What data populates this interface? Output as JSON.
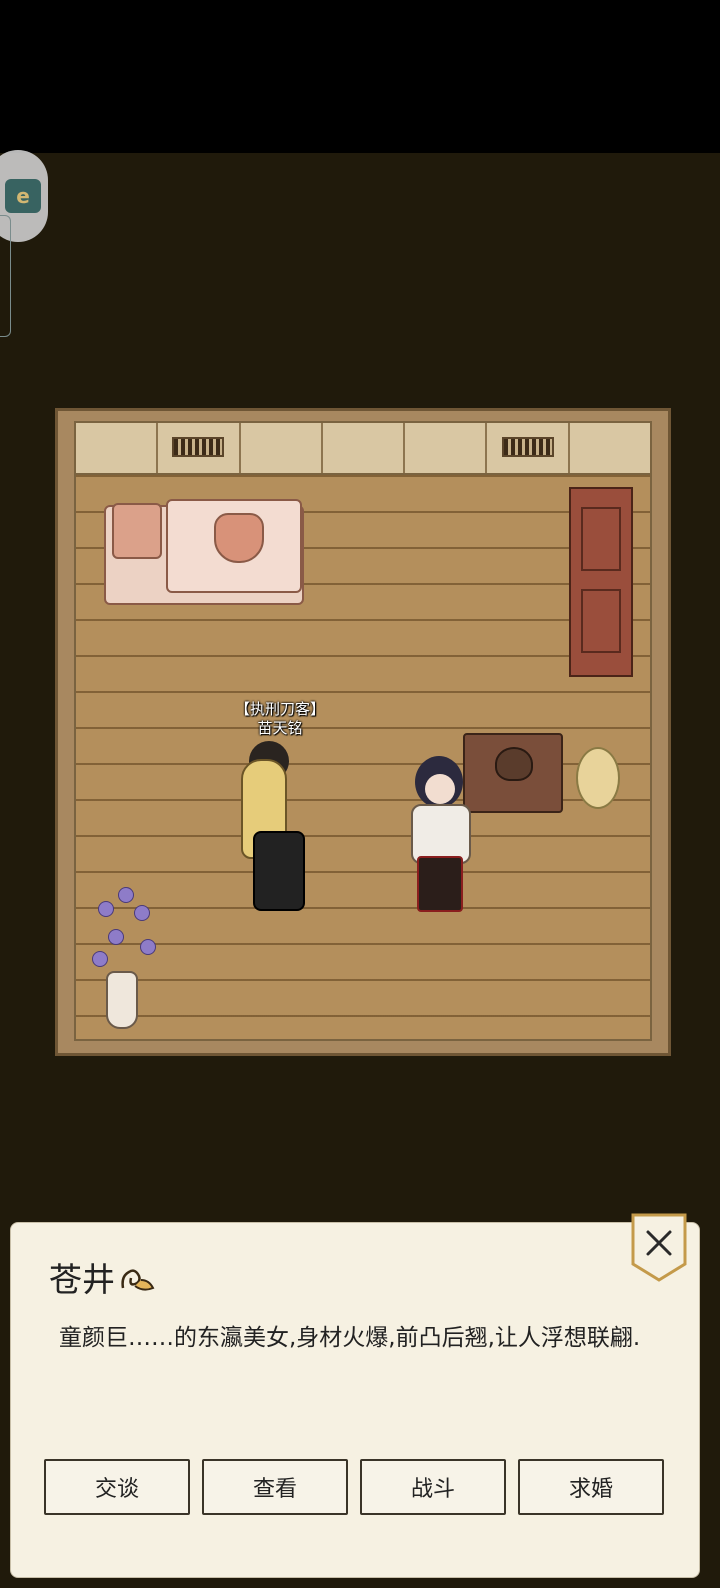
{
  "npc_nameplate": {
    "title": "【执刑刀客】",
    "name": "苗天铭"
  },
  "dialog": {
    "name": "苍井",
    "text": "童颜巨……的东瀛美女,身材火爆,前凸后翘,让人浮想联翩.",
    "close_icon": "close-x-icon"
  },
  "actions": [
    {
      "label": "交谈"
    },
    {
      "label": "查看"
    },
    {
      "label": "战斗"
    },
    {
      "label": "求婚"
    }
  ],
  "colors": {
    "background": "#201a0b",
    "dialog_bg": "#f6f1e2",
    "accent_gold": "#e6c97e"
  }
}
